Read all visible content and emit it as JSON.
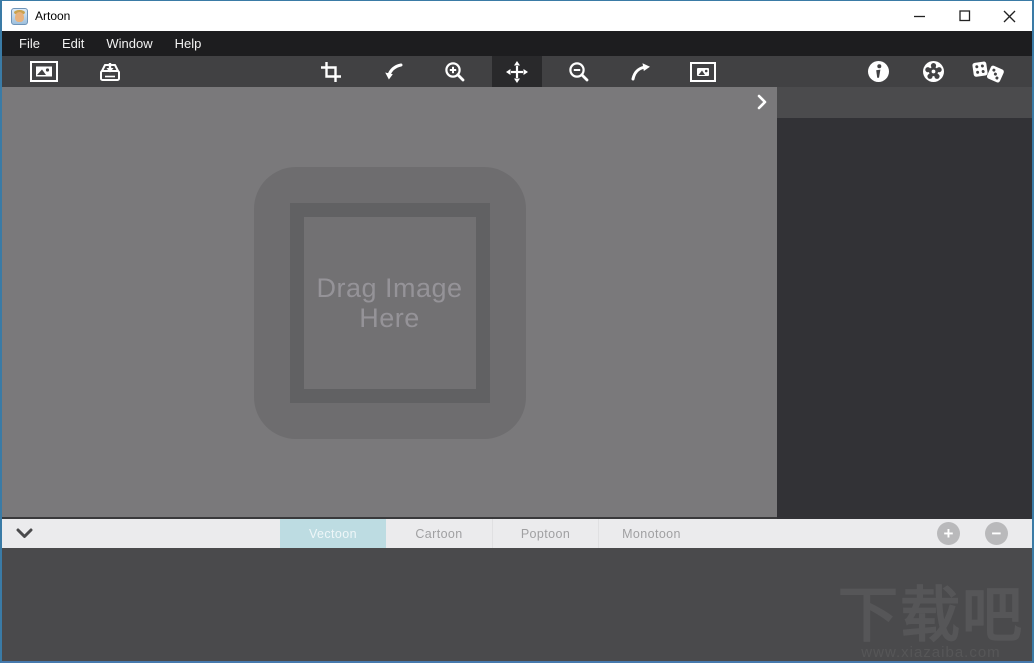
{
  "window": {
    "title": "Artoon",
    "controls": {
      "minimize": "minimize-icon",
      "maximize": "maximize-icon",
      "close": "close-icon"
    }
  },
  "menu": {
    "items": [
      {
        "label": "File"
      },
      {
        "label": "Edit"
      },
      {
        "label": "Window"
      },
      {
        "label": "Help"
      }
    ]
  },
  "toolbar": {
    "left_tools": [
      "open-image-icon",
      "import-image-icon"
    ],
    "center_tools": [
      "crop-icon",
      "undo-icon",
      "zoom-in-icon",
      "move-icon",
      "zoom-out-icon",
      "redo-icon",
      "export-image-icon"
    ],
    "right_tools": [
      "info-icon",
      "settings-icon",
      "random-dice-icon"
    ],
    "selected_tool": "move"
  },
  "canvas": {
    "drop_label": "Drag Image Here",
    "panel_toggle_icon": "chevron-right-icon"
  },
  "stylebar": {
    "collapse_icon": "chevron-down-icon",
    "tabs": [
      {
        "label": "Vectoon",
        "selected": true
      },
      {
        "label": "Cartoon",
        "selected": false
      },
      {
        "label": "Poptoon",
        "selected": false
      },
      {
        "label": "Monotoon",
        "selected": false
      }
    ],
    "add_label": "+",
    "remove_label": "−"
  },
  "watermark": {
    "title": "下载吧",
    "url": "www.xiazaiba.com"
  },
  "colors": {
    "window_border": "#3a7ba6",
    "titlebar_bg": "#ffffff",
    "menubar_bg": "#1d1d1f",
    "toolbar_bg": "#414143",
    "tool_selected_bg": "#29292b",
    "canvas_bg": "#7a797b",
    "dropzone_bg": "#6e6d6f",
    "dropframe_border": "#616163",
    "panel_top_bg": "#4b4b4d",
    "panel_bg": "#323236",
    "tabbar_bg": "#ebebed",
    "tab_selected_bg": "#bddce2",
    "bottom_bg": "#4a4a4c"
  }
}
